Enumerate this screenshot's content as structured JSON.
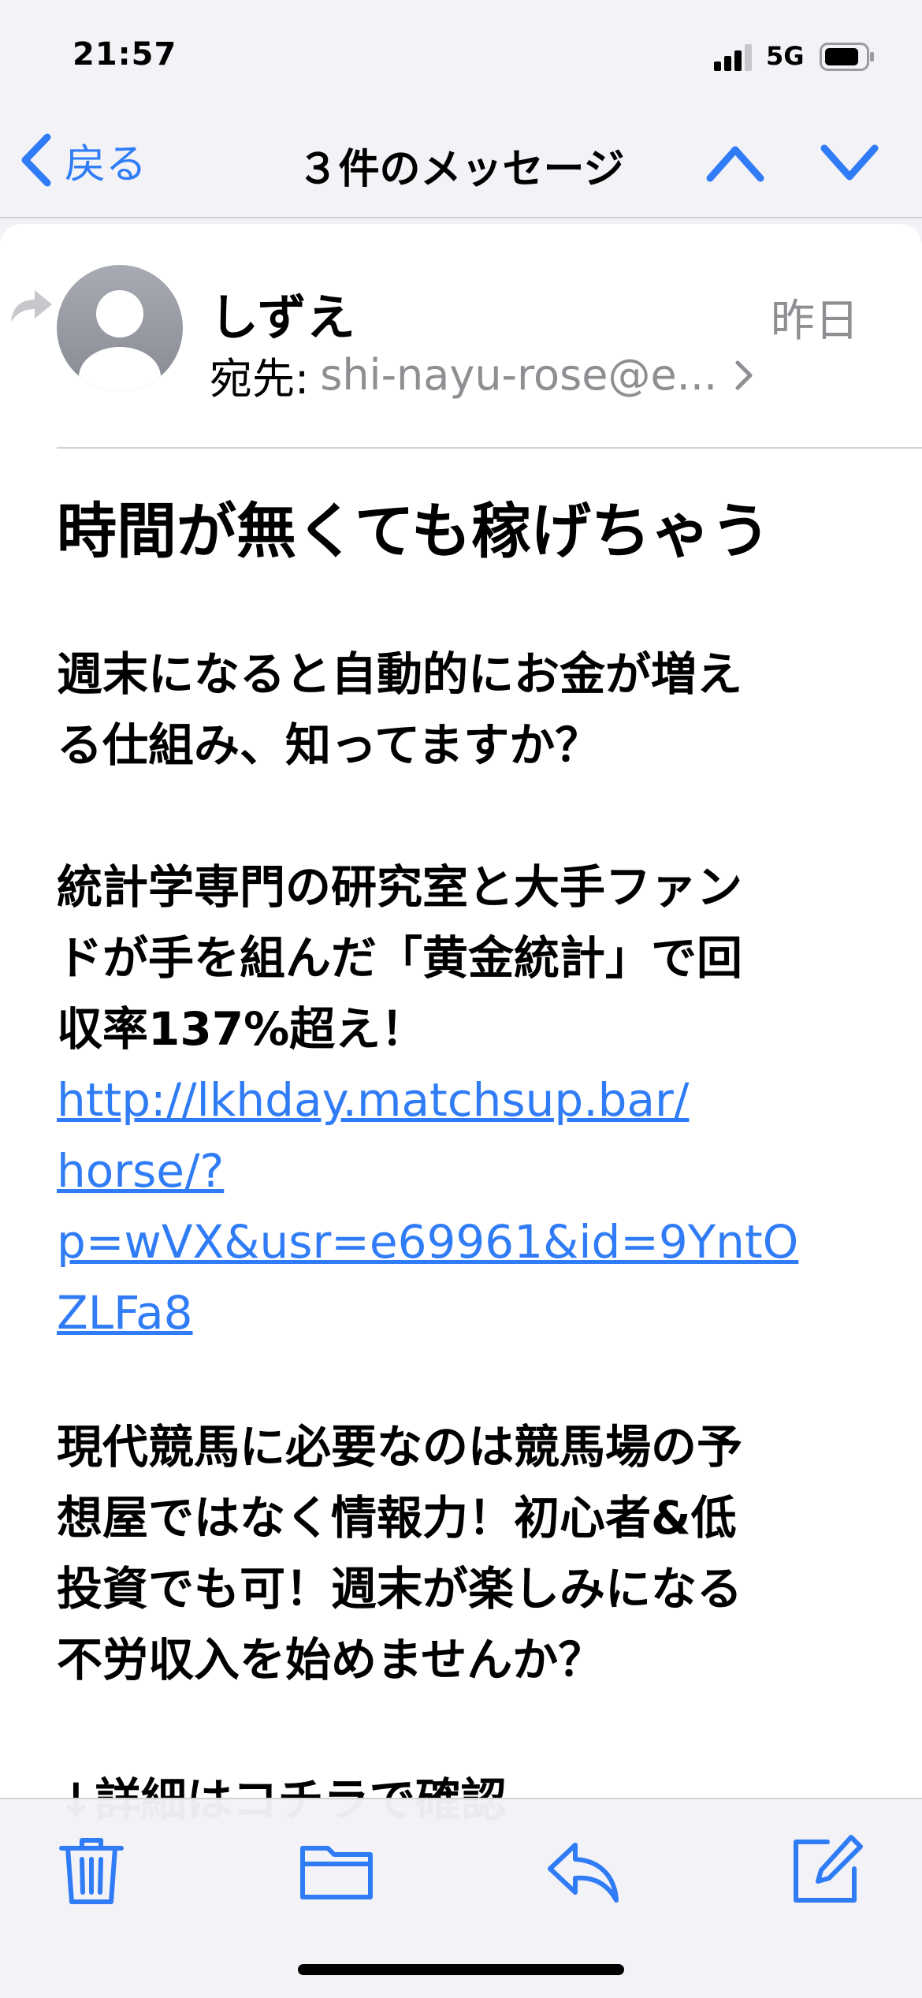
{
  "status_bar": {
    "time": "21:57",
    "network": "5G",
    "battery_icon": "battery-icon",
    "signal_icon": "signal-icon"
  },
  "nav": {
    "back_label": "戻る",
    "title": "３件のメッセージ",
    "up_icon": "chevron-up-icon",
    "down_icon": "chevron-down-icon"
  },
  "message": {
    "sender": "しずえ",
    "date": "昨日",
    "to_label": "宛先:",
    "to_address": "shi-nayu-rose@e...",
    "subject": "時間が無くても稼げちゃう",
    "paragraph1": "週末になると自動的にお金が増え\nる仕組み、知ってますか？",
    "paragraph2": "統計学専門の研究室と大手ファン\nドが手を組んだ「黄金統計」で回\n収率137%超え！",
    "link": "http://lkhday.matchsup.bar/\nhorse/?\np=wVX&usr=e69961&id=9YntO\nZLFa8",
    "paragraph3": "現代競馬に必要なのは競馬場の予\n想屋ではなく情報力！初心者&低\n投資でも可！週末が楽しみになる\n不労収入を始めませんか？",
    "paragraph4": "↓詳細はコチラで確認"
  },
  "toolbar": {
    "items": [
      "trash-icon",
      "folder-icon",
      "reply-icon",
      "compose-icon"
    ]
  },
  "colors": {
    "accent": "#2f7cf6",
    "secondary_text": "#8e8e93",
    "background": "#f2f2f7"
  }
}
